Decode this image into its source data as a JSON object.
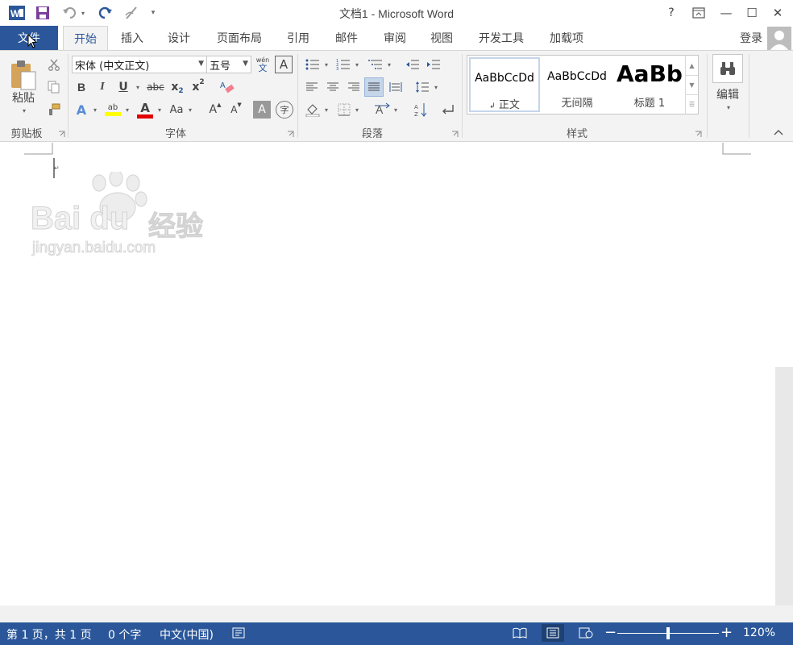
{
  "window": {
    "title": "文档1 - Microsoft Word",
    "help": "?",
    "minimize": "—",
    "maximize": "☐",
    "close": "✕"
  },
  "quick_access": {
    "app_icon": "word-icon",
    "save_icon": "save-icon",
    "undo_icon": "undo-icon",
    "redo_icon": "redo-icon",
    "touch_icon": "touch-mode-icon",
    "customize_icon": "chevron-down-icon"
  },
  "tabs": {
    "file": "文件",
    "items": [
      "开始",
      "插入",
      "设计",
      "页面布局",
      "引用",
      "邮件",
      "审阅",
      "视图",
      "开发工具",
      "加载项"
    ],
    "active": "开始"
  },
  "account": {
    "login": "登录"
  },
  "ribbon": {
    "clipboard": {
      "label": "剪贴板",
      "paste": "粘贴"
    },
    "font": {
      "label": "字体",
      "font_name": "宋体 (中文正文)",
      "font_size": "五号",
      "phonetic_top": "wén",
      "phonetic_bottom": "文",
      "char_border": "A",
      "bold": "B",
      "italic": "I",
      "underline": "U",
      "strike": "abc",
      "subscript": "x",
      "subscript_2": "2",
      "superscript": "x",
      "superscript_2": "2",
      "text_effect": "A",
      "highlight": "ab",
      "font_color": "A",
      "change_case": "Aa",
      "grow": "A",
      "shrink": "A",
      "char_shading": "A",
      "enclose": "字"
    },
    "paragraph": {
      "label": "段落"
    },
    "styles": {
      "label": "样式",
      "items": [
        {
          "sample": "AaBbCcDd",
          "name": "正文",
          "mark": "↲"
        },
        {
          "sample": "AaBbCcDd",
          "name": "无间隔"
        },
        {
          "sample": "AaBb",
          "name": "标题 1"
        }
      ]
    },
    "editing": {
      "label": "编辑"
    }
  },
  "document": {
    "paragraph_mark": "↵",
    "watermark": {
      "brand": "Bai du",
      "brand_cn": "经验",
      "url": "jingyan.baidu.com"
    }
  },
  "statusbar": {
    "page": "第 1 页，共 1 页",
    "words": "0 个字",
    "language": "中文(中国)",
    "zoom": "120%",
    "zoom_out": "−",
    "zoom_in": "+"
  },
  "colors": {
    "accent": "#2b579a",
    "highlight_yellow": "#ffff00",
    "font_red": "#e00000"
  }
}
